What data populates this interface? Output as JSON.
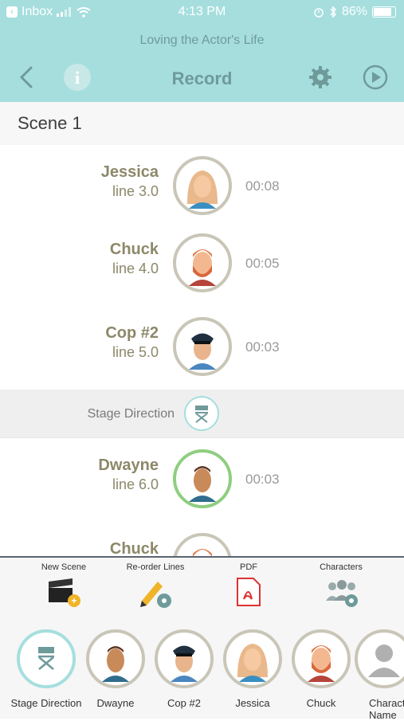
{
  "status_bar": {
    "back_app": "Inbox",
    "time": "4:13 PM",
    "battery": "86%"
  },
  "header": {
    "subtitle": "Loving the Actor's Life",
    "title": "Record"
  },
  "scene": {
    "title": "Scene 1"
  },
  "lines": [
    {
      "character": "Jessica",
      "line": "line 3.0",
      "duration": "00:08",
      "avatar": "jessica-avatar"
    },
    {
      "character": "Chuck",
      "line": "line 4.0",
      "duration": "00:05",
      "avatar": "chuck-avatar"
    },
    {
      "character": "Cop #2",
      "line": "line 5.0",
      "duration": "00:03",
      "avatar": "cop-avatar"
    },
    {
      "character": "Dwayne",
      "line": "line 6.0",
      "duration": "00:03",
      "avatar": "dwayne-avatar"
    },
    {
      "character": "Chuck",
      "avatar": "chuck-avatar"
    }
  ],
  "stage_direction": {
    "label": "Stage Direction",
    "icon": "director-chair-icon"
  },
  "toolbar": {
    "new_scene": "New Scene",
    "reorder": "Re-order Lines",
    "pdf": "PDF",
    "characters": "Characters"
  },
  "character_bar": [
    {
      "label": "Stage Direction"
    },
    {
      "label": "Dwayne"
    },
    {
      "label": "Cop #2"
    },
    {
      "label": "Jessica"
    },
    {
      "label": "Chuck"
    },
    {
      "label": "Character Name"
    }
  ],
  "colors": {
    "header_bg": "#a6dede",
    "header_text": "#6f9a9a",
    "name_text": "#8c8869",
    "active_ring": "#8fce80"
  }
}
